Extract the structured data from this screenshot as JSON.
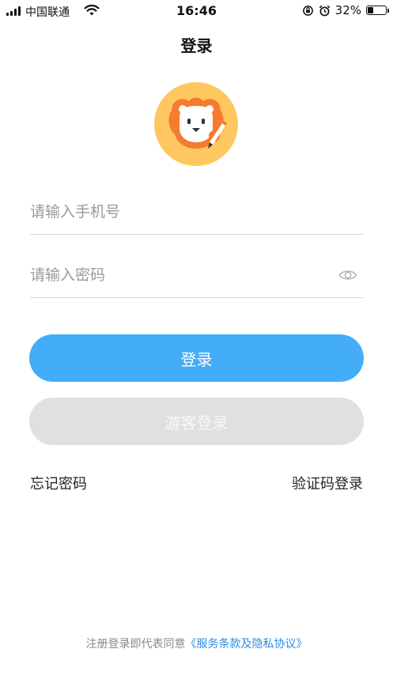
{
  "status_bar": {
    "carrier": "中国联通",
    "time": "16:46",
    "battery_percent": "32%",
    "battery_level": 0.32
  },
  "nav": {
    "title": "登录"
  },
  "logo": {
    "icon": "lion-mascot-logo",
    "bg_color": "#ffc75f",
    "face_color": "#f47b2f"
  },
  "form": {
    "phone_placeholder": "请输入手机号",
    "phone_value": "",
    "password_placeholder": "请输入密码",
    "password_value": "",
    "password_toggle_icon": "eye-icon"
  },
  "buttons": {
    "login_label": "登录",
    "login_color": "#43adf9",
    "guest_label": "游客登录",
    "guest_color": "#e0e0e0"
  },
  "links": {
    "forgot_password": "忘记密码",
    "sms_login": "验证码登录"
  },
  "agreement": {
    "prefix": "注册登录即代表同意",
    "link_text": "《服务条款及隐私协议》"
  }
}
